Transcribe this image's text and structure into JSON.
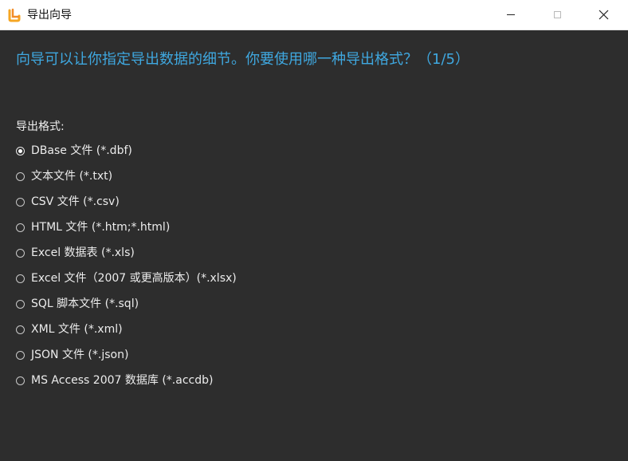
{
  "window": {
    "title": "导出向导",
    "min_label": "",
    "max_label": "",
    "close_label": ""
  },
  "question": "向导可以让你指定导出数据的细节。你要使用哪一种导出格式？（1/5）",
  "format_label": "导出格式:",
  "options": [
    {
      "label": "DBase 文件 (*.dbf)",
      "checked": true
    },
    {
      "label": "文本文件 (*.txt)",
      "checked": false
    },
    {
      "label": "CSV 文件 (*.csv)",
      "checked": false
    },
    {
      "label": "HTML 文件 (*.htm;*.html)",
      "checked": false
    },
    {
      "label": "Excel 数据表 (*.xls)",
      "checked": false
    },
    {
      "label": "Excel 文件（2007 或更高版本）(*.xlsx)",
      "checked": false
    },
    {
      "label": "SQL 脚本文件 (*.sql)",
      "checked": false
    },
    {
      "label": "XML 文件 (*.xml)",
      "checked": false
    },
    {
      "label": "JSON 文件 (*.json)",
      "checked": false
    },
    {
      "label": "MS Access 2007 数据库 (*.accdb)",
      "checked": false
    }
  ],
  "colors": {
    "background": "#2d2d2d",
    "accent": "#3fa8e0",
    "titlebar": "#ffffff",
    "icon_orange": "#f5a623"
  },
  "icons": {
    "app": "app-logo-icon",
    "minimize": "minimize-icon",
    "maximize": "maximize-icon",
    "close": "close-icon"
  }
}
